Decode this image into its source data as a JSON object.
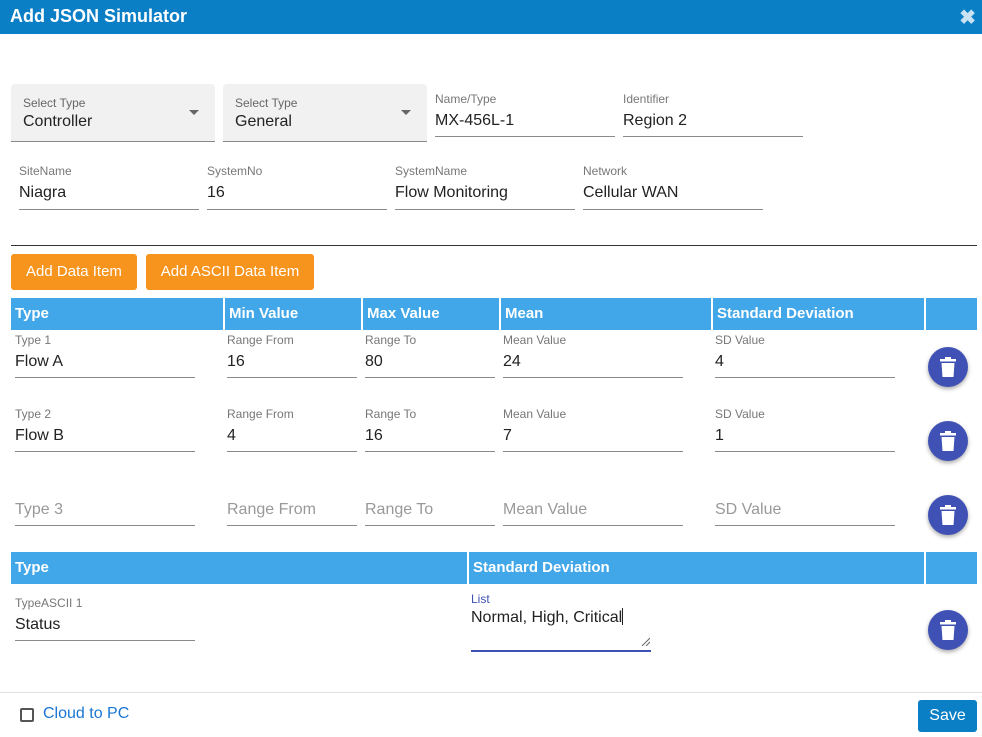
{
  "dialog": {
    "title": "Add JSON Simulator",
    "close_glyph": "✖"
  },
  "header_form": {
    "select_type_1": {
      "label": "Select Type",
      "value": "Controller"
    },
    "select_type_2": {
      "label": "Select Type",
      "value": "General"
    },
    "name_type": {
      "label": "Name/Type",
      "value": "MX-456L-1"
    },
    "identifier": {
      "label": "Identifier",
      "value": "Region 2"
    },
    "site_name": {
      "label": "SiteName",
      "value": "Niagra"
    },
    "system_no": {
      "label": "SystemNo",
      "value": "16"
    },
    "system_name": {
      "label": "SystemName",
      "value": "Flow Monitoring"
    },
    "network": {
      "label": "Network",
      "value": "Cellular WAN"
    }
  },
  "buttons": {
    "add_data_item": "Add Data Item",
    "add_ascii_data_item": "Add ASCII Data Item",
    "save": "Save"
  },
  "data_table": {
    "columns": [
      "Type",
      "Min Value",
      "Max Value",
      "Mean",
      "Standard Deviation"
    ],
    "rows": [
      {
        "type_label": "Type 1",
        "type": "Flow A",
        "min_label": "Range From",
        "min": "16",
        "max_label": "Range To",
        "max": "80",
        "mean_label": "Mean Value",
        "mean": "24",
        "sd_label": "SD Value",
        "sd": "4"
      },
      {
        "type_label": "Type 2",
        "type": "Flow B",
        "min_label": "Range From",
        "min": "4",
        "max_label": "Range To",
        "max": "16",
        "mean_label": "Mean Value",
        "mean": "7",
        "sd_label": "SD Value",
        "sd": "1"
      }
    ],
    "empty_row": {
      "type": "Type 3",
      "min": "Range From",
      "max": "Range To",
      "mean": "Mean Value",
      "sd": "SD Value"
    }
  },
  "ascii_table": {
    "columns": [
      "Type",
      "Standard Deviation"
    ],
    "row": {
      "type_label": "TypeASCII 1",
      "type": "Status",
      "list_label": "List",
      "list": "Normal, High, Critical"
    }
  },
  "footer": {
    "checkbox_label": "Cloud to PC",
    "checkbox_checked": false
  },
  "colors": {
    "title_bar": "#0a7fc6",
    "table_header": "#42a7e8",
    "orange_button": "#f7941d",
    "delete_button": "#3f51b5"
  }
}
